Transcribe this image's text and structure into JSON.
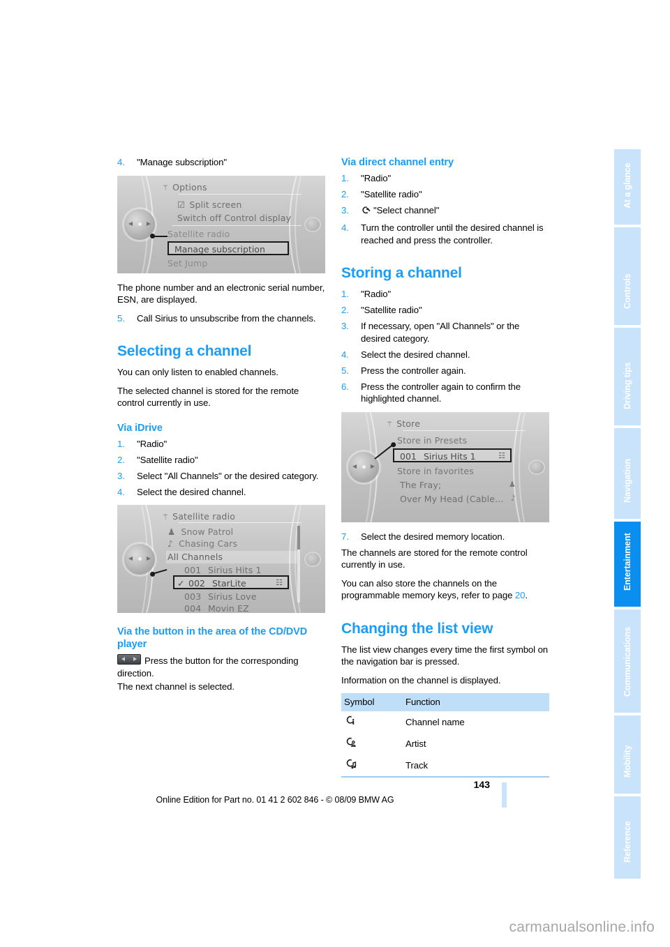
{
  "page": {
    "number": "143",
    "edition_line": "Online Edition for Part no. 01 41 2 602 846 - © 08/09 BMW AG",
    "watermark": "carmanualsonline.info"
  },
  "colors": {
    "accent_blue": "#1b9cf5",
    "tab_inactive": "#c9e4fa",
    "tab_active": "#0a8ef0",
    "table_header": "#bfdef7",
    "table_rule": "#9dcdf0"
  },
  "nav_rail": {
    "tabs": [
      {
        "label": "At a glance",
        "active": false
      },
      {
        "label": "Controls",
        "active": false
      },
      {
        "label": "Driving tips",
        "active": false
      },
      {
        "label": "Navigation",
        "active": false
      },
      {
        "label": "Entertainment",
        "active": true
      },
      {
        "label": "Communications",
        "active": false
      },
      {
        "label": "Mobility",
        "active": false
      },
      {
        "label": "Reference",
        "active": false
      }
    ]
  },
  "left_column": {
    "manage_step": {
      "num": "4.",
      "text": "\"Manage subscription\""
    },
    "options_screenshot": {
      "title": "Options",
      "rows": [
        "Split screen",
        "Switch off Control display",
        "Satellite radio",
        "Set Jump"
      ],
      "highlighted_row": "Manage subscription"
    },
    "esn_paragraph": "The phone number and an electronic serial number, ESN, are displayed.",
    "unsubscribe_step": {
      "num": "5.",
      "text": "Call Sirius to unsubscribe from the channels."
    },
    "selecting_heading": "Selecting a channel",
    "selecting_paragraphs": [
      "You can only listen to enabled channels.",
      "The selected channel is stored for the remote control currently in use."
    ],
    "via_idrive_heading": "Via iDrive",
    "via_idrive_steps": [
      {
        "num": "1.",
        "text": "\"Radio\""
      },
      {
        "num": "2.",
        "text": "\"Satellite radio\""
      },
      {
        "num": "3.",
        "text": "Select \"All Channels\" or the desired category."
      },
      {
        "num": "4.",
        "text": "Select the desired channel."
      }
    ],
    "satellite_screenshot": {
      "title": "Satellite radio",
      "artist_row": "Snow Patrol",
      "track_row": "Chasing Cars",
      "band_row": "All Channels",
      "channels": [
        {
          "num": "001",
          "name": "Sirius Hits 1"
        },
        {
          "num": "003",
          "name": "Sirius Love"
        },
        {
          "num": "004",
          "name": "Movin EZ"
        }
      ],
      "highlighted": {
        "num": "002",
        "name": "StarLite"
      }
    },
    "cd_dvd_heading": "Via the button in the area of the CD/DVD player",
    "cd_dvd_text": "Press the button for the corresponding direction.",
    "cd_dvd_text2": "The next channel is selected."
  },
  "right_column": {
    "direct_entry_heading": "Via direct channel entry",
    "direct_entry_steps": [
      {
        "num": "1.",
        "text": "\"Radio\""
      },
      {
        "num": "2.",
        "text": "\"Satellite radio\""
      },
      {
        "num": "3.",
        "text": "\"Select channel\"",
        "icon": "select-channel-icon"
      },
      {
        "num": "4.",
        "text": "Turn the controller until the desired channel is reached and press the controller."
      }
    ],
    "storing_heading": "Storing a channel",
    "storing_steps": [
      {
        "num": "1.",
        "text": "\"Radio\""
      },
      {
        "num": "2.",
        "text": "\"Satellite radio\""
      },
      {
        "num": "3.",
        "text": "If necessary, open \"All Channels\" or the desired category."
      },
      {
        "num": "4.",
        "text": "Select the desired channel."
      },
      {
        "num": "5.",
        "text": "Press the controller again."
      },
      {
        "num": "6.",
        "text": "Press the controller again to confirm the highlighted channel."
      }
    ],
    "store_screenshot": {
      "title": "Store",
      "presets_label": "Store in Presets",
      "highlighted": {
        "num": "001",
        "name": "Sirius Hits 1"
      },
      "favorites_label": "Store in favorites",
      "favorites": [
        {
          "name": "The Fray;",
          "icon": "artist-icon"
        },
        {
          "name": "Over My Head (Cable...",
          "icon": "track-icon"
        }
      ]
    },
    "memory_step": {
      "num": "7.",
      "text": "Select the desired memory location."
    },
    "after_store_paragraph": "The channels are stored for the remote control currently in use.",
    "programmable_text_before": "You can also store the channels on the programmable memory keys, refer to page ",
    "programmable_page": "20",
    "programmable_text_after": ".",
    "list_view_heading": "Changing the list view",
    "list_view_paragraphs": [
      "The list view changes every time the first symbol on the navigation bar is pressed.",
      "Information on the channel is displayed."
    ],
    "symbol_table": {
      "headers": [
        "Symbol",
        "Function"
      ],
      "rows": [
        {
          "icon": "channel-name-icon",
          "function": "Channel name"
        },
        {
          "icon": "artist-icon",
          "function": "Artist"
        },
        {
          "icon": "track-icon",
          "function": "Track"
        }
      ]
    }
  }
}
